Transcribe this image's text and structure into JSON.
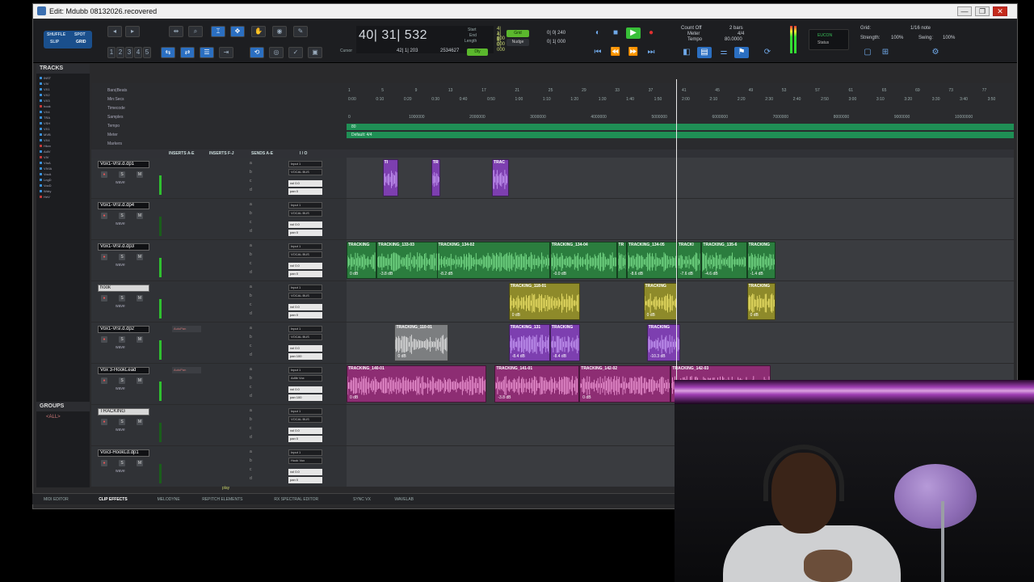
{
  "window": {
    "title": "Edit: Mdubb 08132026.recovered",
    "controls": [
      "—",
      "❐",
      "✕"
    ]
  },
  "toolbar": {
    "mode_labels": [
      "SHUFFLE",
      "SPOT",
      "SLIP",
      "GRID"
    ],
    "track_height_buttons": [
      "1",
      "2",
      "3",
      "4",
      "5"
    ],
    "main_counter": "40| 31| 532",
    "counter_fields": {
      "start_label": "Start",
      "end_label": "End",
      "length_label": "Length",
      "start": "4| 1| 000",
      "end": "4| 1| 000",
      "length": "0| 0| 000"
    },
    "cursor_label": "Cursor",
    "cursor_value": "42| 1| 203",
    "sample_value": "2534627",
    "grid_pill": "Grid",
    "nudge_pill": "Nudge",
    "grid_value": "0| 0| 240",
    "nudge_value": "0| 1| 000",
    "dly_label": "Dly",
    "count_off": "Count Off",
    "meter_label": "Meter",
    "tempo_label": "Tempo",
    "count_value": "2 bars",
    "meter_value": "4/4",
    "tempo_value": "80.0000",
    "eucon_title": "EUCON",
    "eucon_status": "Status",
    "grid_label": "Grid:",
    "grid_note": "1/16 note",
    "strength_label": "Strength:",
    "strength_value": "100%",
    "timing_value": "100%",
    "swing_label": "Swing:"
  },
  "tracks_panel": {
    "title": "TRACKS",
    "items": [
      "INST",
      "VIV",
      "VX1",
      "VX2",
      "VX3",
      "hook",
      "VX4",
      "TRA",
      "VSH",
      "VX1",
      "MVB",
      "VX4",
      "Hkvx",
      "AdlV",
      "VIV",
      "VIoA",
      "VIVIA",
      "VocA",
      "LngD",
      "VocD",
      "Wdry",
      "HnV"
    ],
    "groups_title": "GROUPS",
    "groups_all": "<ALL>"
  },
  "rulers": {
    "labels": [
      "Bars|Beats",
      "Min:Secs",
      "Timecode",
      "Samples",
      "Tempo",
      "Meter",
      "Markers"
    ],
    "bars": [
      "1",
      "5",
      "9",
      "13",
      "17",
      "21",
      "25",
      "29",
      "33",
      "37",
      "41",
      "45",
      "49",
      "53",
      "57",
      "61",
      "65",
      "69",
      "73",
      "77"
    ],
    "minsecs": [
      "0:00",
      "0:10",
      "0:20",
      "0:30",
      "0:40",
      "0:50",
      "1:00",
      "1:10",
      "1:20",
      "1:30",
      "1:40",
      "1:50",
      "2:00",
      "2:10",
      "2:20",
      "2:30",
      "2:40",
      "2:50",
      "3:00",
      "3:10",
      "3:20",
      "3:30",
      "3:40",
      "3:50"
    ],
    "samples": [
      "0",
      "1000000",
      "2000000",
      "3000000",
      "4000000",
      "5000000",
      "6000000",
      "7000000",
      "8000000",
      "9000000",
      "10000000"
    ],
    "tempo_value": "80",
    "meter_value": "Default: 4/4"
  },
  "columns": [
    "INSERTS A-E",
    "INSERTS F-J",
    "SENDS A-E",
    "I / O"
  ],
  "tracks": [
    {
      "name": "Vox1-Vrsl.d.dp1",
      "input": "Input 1",
      "output": "VOCAL BUS",
      "vol": "0.0",
      "pan": "0",
      "light": false,
      "insert": "",
      "clips": [
        {
          "label": "TI",
          "color": "violet",
          "start": 0.054,
          "width": 0.024,
          "gain": ""
        },
        {
          "label": "TR",
          "color": "violet",
          "start": 0.127,
          "width": 0.013,
          "gain": ""
        },
        {
          "label": "TRAC",
          "color": "violet",
          "start": 0.218,
          "width": 0.025,
          "gain": ""
        }
      ]
    },
    {
      "name": "Vox1-Vrsl.d.dp4",
      "input": "Input 1",
      "output": "VOCAL BUS",
      "vol": "0.0",
      "pan": "0",
      "light": false,
      "insert": "",
      "clips": []
    },
    {
      "name": "Vox1-Vrsl.d.dp3",
      "input": "Input 1",
      "output": "VOCAL BUS",
      "vol": "0.0",
      "pan": "0",
      "light": false,
      "insert": "",
      "clips": [
        {
          "label": "TRACKING",
          "color": "green",
          "start": 0.0,
          "width": 0.045,
          "gain": "0 dB"
        },
        {
          "label": "TRACKING_133-03",
          "color": "green",
          "start": 0.045,
          "width": 0.1,
          "gain": "-3.8 dB"
        },
        {
          "label": "TRACKING_134-02",
          "color": "green",
          "start": 0.135,
          "width": 0.17,
          "gain": "-8.2 dB"
        },
        {
          "label": "TRACKING_134-04",
          "color": "green",
          "start": 0.305,
          "width": 0.1,
          "gain": "-0.0 dB"
        },
        {
          "label": "TR",
          "color": "green",
          "start": 0.405,
          "width": 0.015,
          "gain": ""
        },
        {
          "label": "TRACKING_134-05",
          "color": "green",
          "start": 0.42,
          "width": 0.075,
          "gain": "-8.6 dB"
        },
        {
          "label": "TRACKI",
          "color": "green",
          "start": 0.495,
          "width": 0.037,
          "gain": "-7.6 dB"
        },
        {
          "label": "TRACKING_135-6",
          "color": "green",
          "start": 0.532,
          "width": 0.068,
          "gain": "-4.6 dB"
        },
        {
          "label": "TRACKING",
          "color": "green",
          "start": 0.6,
          "width": 0.043,
          "gain": "-1.4 dB"
        }
      ]
    },
    {
      "name": "hook",
      "input": "Input 1",
      "output": "VOCAL BUS",
      "vol": "0.0",
      "pan": "0",
      "light": true,
      "insert": "",
      "clips": [
        {
          "label": "TRACKING_118-01",
          "color": "yellow",
          "start": 0.243,
          "width": 0.107,
          "gain": "0 dB"
        },
        {
          "label": "TRACKING",
          "color": "yellow",
          "start": 0.445,
          "width": 0.05,
          "gain": "0 dB"
        },
        {
          "label": "TRACKING",
          "color": "yellow",
          "start": 0.6,
          "width": 0.043,
          "gain": "0 dB"
        }
      ]
    },
    {
      "name": "Vox1-Vrsl.d.dp2",
      "input": "Input 1",
      "output": "VOCAL BUS",
      "vol": "0.0",
      "pan": "100",
      "light": false,
      "insert": "AutoPan",
      "clips": [
        {
          "label": "TRACKING_110-01",
          "color": "gray",
          "start": 0.072,
          "width": 0.08,
          "gain": "0 dB"
        },
        {
          "label": "TRACKING_131",
          "color": "violet",
          "start": 0.243,
          "width": 0.062,
          "gain": "-8.4 dB"
        },
        {
          "label": "TRACKING",
          "color": "violet",
          "start": 0.305,
          "width": 0.045,
          "gain": "-8.4 dB"
        },
        {
          "label": "TRACKING",
          "color": "violet",
          "start": 0.45,
          "width": 0.05,
          "gain": "-10.3 dB"
        }
      ]
    },
    {
      "name": "Vox 3-HookLead",
      "input": "Input 1",
      "output": "Adlib Vox",
      "vol": "0.0",
      "pan": "100",
      "light": false,
      "insert": "AutoPan",
      "clips": [
        {
          "label": "TRACKING_140-01",
          "color": "pink",
          "start": 0.0,
          "width": 0.21,
          "gain": "0 dB"
        },
        {
          "label": "TRACKING_141-01",
          "color": "pink",
          "start": 0.222,
          "width": 0.127,
          "gain": "-3.8 dB"
        },
        {
          "label": "TRACKING_142-02",
          "color": "pink",
          "start": 0.349,
          "width": 0.137,
          "gain": "0 dB"
        },
        {
          "label": "TRACKING_142-03",
          "color": "pink",
          "start": 0.486,
          "width": 0.15,
          "gain": ""
        }
      ]
    },
    {
      "name": "TRACKING",
      "input": "Input 1",
      "output": "VOCAL BUS",
      "vol": "0.0",
      "pan": "0",
      "light": true,
      "insert": "",
      "clips": []
    },
    {
      "name": "Vox3-HookLd.dp1",
      "input": "Input 1",
      "output": "Hook Vox",
      "vol": "0.0",
      "pan": "0",
      "light": false,
      "insert": "",
      "clips": []
    }
  ],
  "track_controls": {
    "s": "S",
    "r": "●",
    "m": "M",
    "view": "wave",
    "sends": [
      "a",
      "b",
      "c",
      "d"
    ],
    "vol_label": "vol",
    "pan_label": "pan"
  },
  "bottom_bar": {
    "tabs": [
      "MIDI EDITOR",
      "CLIP EFFECTS",
      "MELODYNE",
      "REPITCH ELEMENTS",
      "RX SPECTRAL EDITOR",
      "SYNC VX",
      "WAVELAB"
    ],
    "active": "CLIP EFFECTS",
    "play_label": "play"
  },
  "colors": {
    "green": "#2b7d3e",
    "yellow": "#8e8a2a",
    "violet": "#7d3fb0",
    "pink": "#8d2d73",
    "gray": "#7c7e80",
    "wave_green": "#7be08c",
    "wave_yellow": "#f0e56a",
    "wave_violet": "#c79bf5",
    "wave_pink": "#f19ad8",
    "wave_gray": "#e3e3e3"
  },
  "playhead_bar": 41
}
